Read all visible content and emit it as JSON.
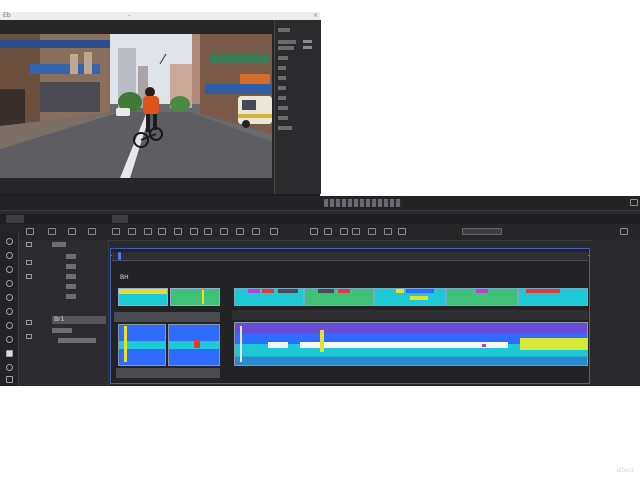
{
  "viewer": {
    "title": "Eb",
    "window_buttons": [
      "–",
      "×"
    ]
  },
  "timeline": {
    "label_a": "Br1",
    "label_b": "BH"
  },
  "watermark": "aitecs",
  "colors": {
    "accent": "#4d7bff",
    "clip_green": "#3fc17a",
    "clip_cyan": "#1ec9d6",
    "clip_yellow": "#e8e02a",
    "clip_red": "#e03a3a",
    "clip_blue": "#2f6bff",
    "clip_magenta": "#c43ccf"
  }
}
